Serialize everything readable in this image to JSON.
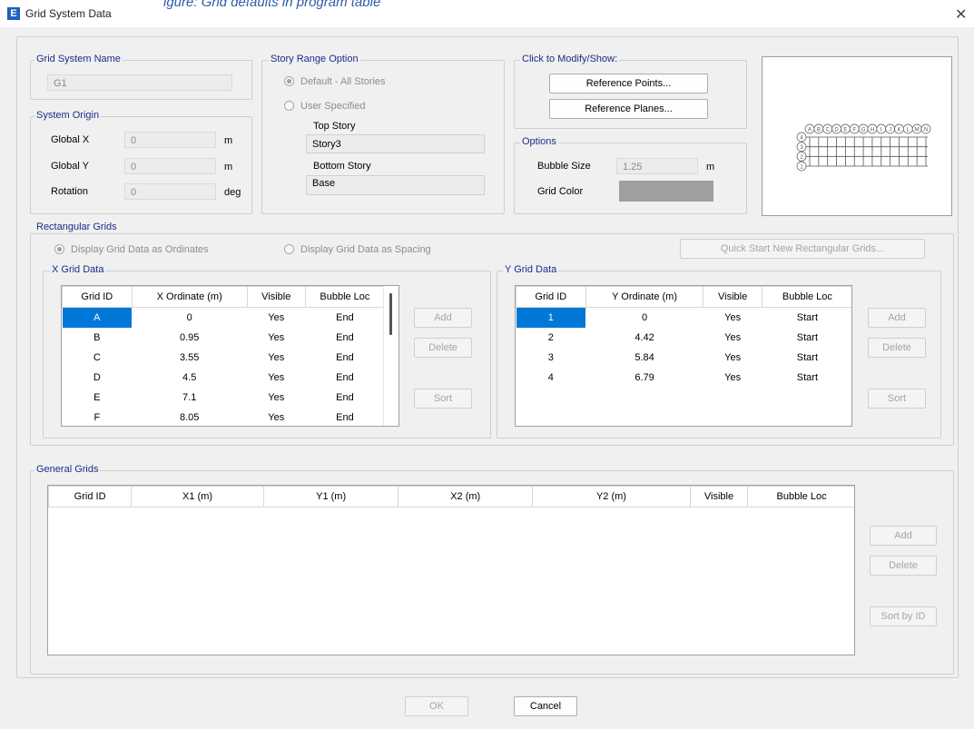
{
  "window": {
    "title": "Grid System Data",
    "close_glyph": "✕",
    "app_icon_letter": "E",
    "overlay_text": "igure: Grid defaults in program table"
  },
  "grid_system_name": {
    "label": "Grid System Name",
    "value": "G1"
  },
  "system_origin": {
    "label": "System Origin",
    "global_x": {
      "label": "Global  X",
      "value": "0",
      "unit": "m"
    },
    "global_y": {
      "label": "Global  Y",
      "value": "0",
      "unit": "m"
    },
    "rotation": {
      "label": "Rotation",
      "value": "0",
      "unit": "deg"
    }
  },
  "story_range": {
    "label": "Story Range Option",
    "default_option": "Default - All Stories",
    "user_option": "User Specified",
    "top_story_label": "Top Story",
    "top_story_value": "Story3",
    "bottom_story_label": "Bottom Story",
    "bottom_story_value": "Base",
    "selected": "default"
  },
  "modify_show": {
    "label": "Click to Modify/Show:",
    "reference_points": "Reference Points...",
    "reference_planes": "Reference Planes..."
  },
  "options": {
    "label": "Options",
    "bubble_size_label": "Bubble Size",
    "bubble_size_value": "1.25",
    "bubble_size_unit": "m",
    "grid_color_label": "Grid Color",
    "grid_color": "#9f9f9f"
  },
  "rectangular_grids": {
    "label": "Rectangular Grids",
    "ordinates_option": "Display Grid Data as Ordinates",
    "spacing_option": "Display Grid Data as Spacing",
    "selected": "ordinates",
    "quick_start": "Quick Start New Rectangular Grids..."
  },
  "x_grid": {
    "label": "X Grid Data",
    "columns": [
      "Grid ID",
      "X Ordinate (m)",
      "Visible",
      "Bubble Loc"
    ],
    "rows": [
      [
        "A",
        "0",
        "Yes",
        "End"
      ],
      [
        "B",
        "0.95",
        "Yes",
        "End"
      ],
      [
        "C",
        "3.55",
        "Yes",
        "End"
      ],
      [
        "D",
        "4.5",
        "Yes",
        "End"
      ],
      [
        "E",
        "7.1",
        "Yes",
        "End"
      ],
      [
        "F",
        "8.05",
        "Yes",
        "End"
      ]
    ],
    "add": "Add",
    "delete": "Delete",
    "sort": "Sort"
  },
  "y_grid": {
    "label": "Y Grid Data",
    "columns": [
      "Grid ID",
      "Y Ordinate (m)",
      "Visible",
      "Bubble Loc"
    ],
    "rows": [
      [
        "1",
        "0",
        "Yes",
        "Start"
      ],
      [
        "2",
        "4.42",
        "Yes",
        "Start"
      ],
      [
        "3",
        "5.84",
        "Yes",
        "Start"
      ],
      [
        "4",
        "6.79",
        "Yes",
        "Start"
      ]
    ],
    "add": "Add",
    "delete": "Delete",
    "sort": "Sort"
  },
  "general_grids": {
    "label": "General Grids",
    "columns": [
      "Grid ID",
      "X1 (m)",
      "Y1 (m)",
      "X2 (m)",
      "Y2 (m)",
      "Visible",
      "Bubble Loc"
    ],
    "add": "Add",
    "delete": "Delete",
    "sort_by_id": "Sort by ID"
  },
  "preview": {
    "x_bubbles": [
      "A",
      "B",
      "C",
      "D",
      "E",
      "F",
      "G",
      "H",
      "I",
      "J",
      "K",
      "L",
      "M",
      "N"
    ],
    "y_bubbles": [
      "4",
      "3",
      "2",
      "1"
    ]
  },
  "footer": {
    "ok": "OK",
    "cancel": "Cancel"
  }
}
